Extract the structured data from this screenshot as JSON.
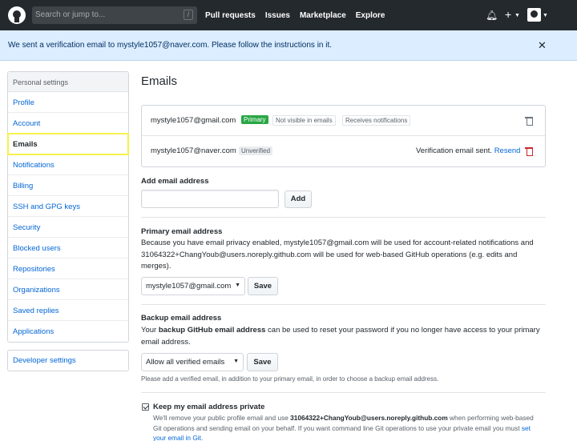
{
  "header": {
    "search_placeholder": "Search or jump to...",
    "search_shortcut": "/",
    "nav": [
      "Pull requests",
      "Issues",
      "Marketplace",
      "Explore"
    ],
    "icons": [
      "github-logo",
      "bell-icon",
      "plus-icon",
      "avatar"
    ]
  },
  "flash": {
    "message": "We sent a verification email to mystyle1057@naver.com. Please follow the instructions in it.",
    "close": "✕"
  },
  "sidebar": {
    "heading": "Personal settings",
    "items": [
      "Profile",
      "Account",
      "Emails",
      "Notifications",
      "Billing",
      "SSH and GPG keys",
      "Security",
      "Blocked users",
      "Repositories",
      "Organizations",
      "Saved replies",
      "Applications"
    ],
    "selected": "Emails",
    "developer": "Developer settings"
  },
  "main": {
    "title": "Emails",
    "emails": [
      {
        "address": "mystyle1057@gmail.com",
        "labels": [
          "Primary",
          "Not visible in emails",
          "Receives notifications"
        ]
      },
      {
        "address": "mystyle1057@naver.com",
        "labels": [
          "Unverified"
        ],
        "status": "Verification email sent.",
        "resend": "Resend"
      }
    ],
    "add": {
      "label": "Add email address",
      "value": "",
      "button": "Add"
    },
    "primary": {
      "label": "Primary email address",
      "text": "Because you have email privacy enabled, mystyle1057@gmail.com will be used for account-related notifications and 31064322+ChangYoub@users.noreply.github.com will be used for web-based GitHub operations (e.g. edits and merges).",
      "selected": "mystyle1057@gmail.com",
      "button": "Save"
    },
    "backup": {
      "label": "Backup email address",
      "text_prefix": "Your ",
      "text_strong": "backup GitHub email address",
      "text_suffix": " can be used to reset your password if you no longer have access to your primary email address.",
      "selected": "Allow all verified emails",
      "button": "Save",
      "note": "Please add a verified email, in addition to your primary email, in order to choose a backup email address."
    },
    "private": {
      "checked": true,
      "label": "Keep my email address private",
      "text1": "We'll remove your public profile email and use ",
      "text_strong": "31064322+ChangYoub@users.noreply.github.com",
      "text2": " when performing web-based Git operations and sending email on your behalf. If you want command line Git operations to use your private email you must ",
      "link": "set your email in Git",
      "text3": "."
    }
  },
  "colors": {
    "header": "#24292e",
    "flash": "#dbedff",
    "link": "#0366d6",
    "primary_label": "#28a745",
    "danger": "#cb2431",
    "highlight": "#f5f24a"
  }
}
